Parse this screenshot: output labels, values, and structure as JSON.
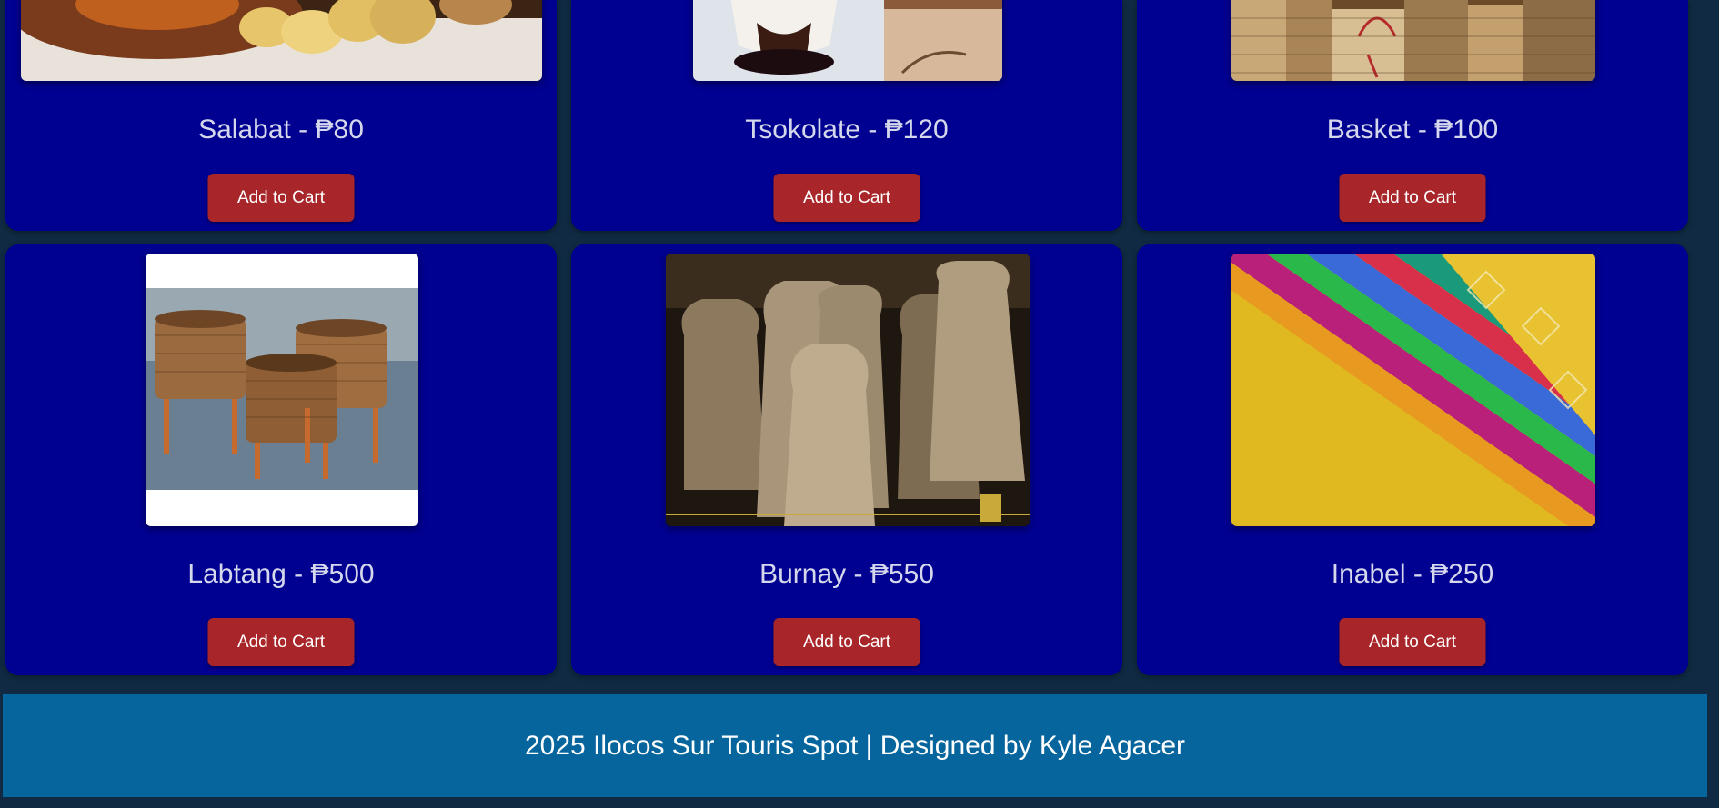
{
  "products": [
    {
      "title": "Salabat - ₱80",
      "button_label": "Add to Cart"
    },
    {
      "title": "Tsokolate - ₱120",
      "button_label": "Add to Cart"
    },
    {
      "title": "Basket - ₱100",
      "button_label": "Add to Cart"
    },
    {
      "title": "Labtang - ₱500",
      "button_label": "Add to Cart"
    },
    {
      "title": "Burnay - ₱550",
      "button_label": "Add to Cart"
    },
    {
      "title": "Inabel - ₱250",
      "button_label": "Add to Cart"
    }
  ],
  "footer": {
    "text": "2025 Ilocos Sur Touris Spot | Designed by Kyle Agacer"
  },
  "colors": {
    "page_background": "#0f2a42",
    "card_background": "#000091",
    "button_background": "#a8262a",
    "footer_background": "#05659c",
    "title_text": "#d5d8ec"
  }
}
